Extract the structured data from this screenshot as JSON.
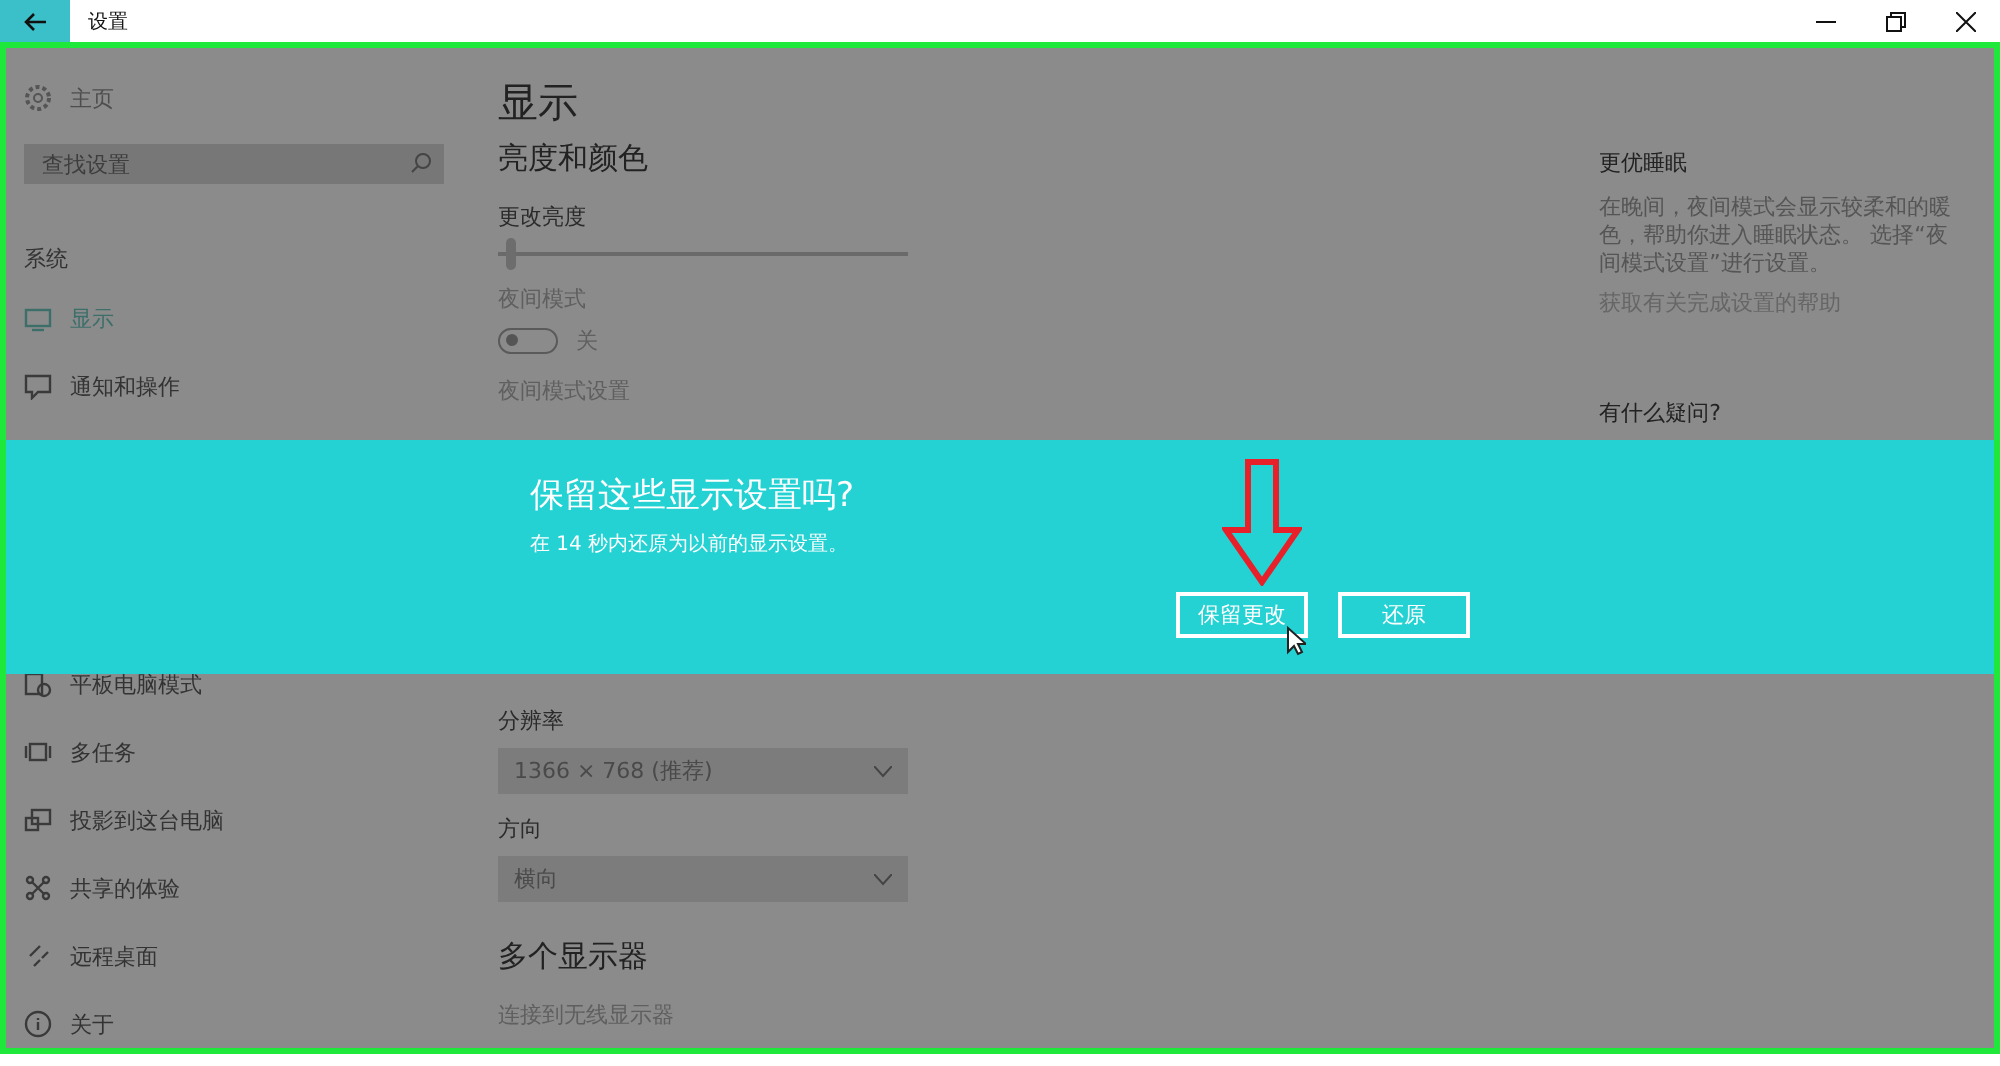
{
  "window": {
    "title": "设置"
  },
  "sidebar": {
    "home": "主页",
    "search": {
      "placeholder": "查找设置"
    },
    "section": "系统",
    "items": [
      {
        "label": "显示",
        "selected": true
      },
      {
        "label": "通知和操作",
        "selected": false
      },
      {
        "label": "平板电脑模式",
        "selected": false
      },
      {
        "label": "多任务",
        "selected": false
      },
      {
        "label": "投影到这台电脑",
        "selected": false
      },
      {
        "label": "共享的体验",
        "selected": false
      },
      {
        "label": "远程桌面",
        "selected": false
      },
      {
        "label": "关于",
        "selected": false
      }
    ]
  },
  "main": {
    "title": "显示",
    "brightness_heading": "亮度和颜色",
    "brightness_label": "更改亮度",
    "brightness": {
      "level": 0.02
    },
    "night_label": "夜间模式",
    "night_toggle": {
      "on": false,
      "state": "关"
    },
    "night_settings": "夜间模式设置",
    "resolution_label": "分辨率",
    "resolution": "1366 × 768 (推荐)",
    "orientation_label": "方向",
    "orientation": "横向",
    "multi_heading": "多个显示器",
    "wireless_link": "连接到无线显示器"
  },
  "aside": {
    "heading": "更优睡眠",
    "text": "在晚间，夜间模式会显示较柔和的暖色，帮助你进入睡眠状态。 选择“夜间模式设置”进行设置。",
    "link": "获取有关完成设置的帮助",
    "question": "有什么疑问?"
  },
  "dialog": {
    "title": "保留这些显示设置吗?",
    "message": "在 14 秒内还原为以前的显示设置。",
    "buttons": [
      "保留更改",
      "还原"
    ]
  }
}
